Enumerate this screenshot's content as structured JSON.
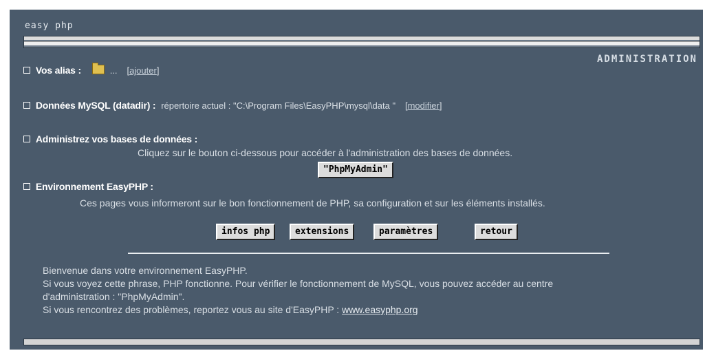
{
  "logo": {
    "text": "easy php"
  },
  "header": {
    "title": "ADMINISTRATION"
  },
  "alias": {
    "label": "Vos alias :",
    "suffix": "...",
    "add_open": "[",
    "add_label": "ajouter",
    "add_close": "]",
    "icon": "folder-icon"
  },
  "mysql": {
    "label": "Données MySQL (datadir) :",
    "text": "répertoire actuel : \"C:\\Program Files\\EasyPHP\\mysql\\data \"",
    "modify_open": "[",
    "modify_label": "modifier",
    "modify_close": "]"
  },
  "databases": {
    "label": "Administrez vos bases de données :",
    "description": "Cliquez sur le bouton ci-dessous pour accéder à l'administration des bases de données.",
    "button": "\"PhpMyAdmin\""
  },
  "environment": {
    "label": "Environnement EasyPHP :",
    "description": "Ces pages vous informeront sur le bon fonctionnement de PHP, sa configuration et sur les éléments installés.",
    "buttons": [
      "infos php",
      "extensions",
      "paramètres",
      "retour"
    ]
  },
  "footer": {
    "line1": "Bienvenue dans votre environnement EasyPHP.",
    "line2": "Si vous voyez cette phrase, PHP fonctionne. Pour vérifier le fonctionnement de MySQL, vous pouvez accéder au centre",
    "line3": "d'administration : \"PhpMyAdmin\".",
    "line4_prefix": "Si vous rencontrez des problèmes, reportez vous au site d'EasyPHP : ",
    "link": "www.easyphp.org"
  },
  "colors": {
    "background": "#4a5a6b",
    "text": "#ffffff",
    "button": "#dcdcdc"
  }
}
